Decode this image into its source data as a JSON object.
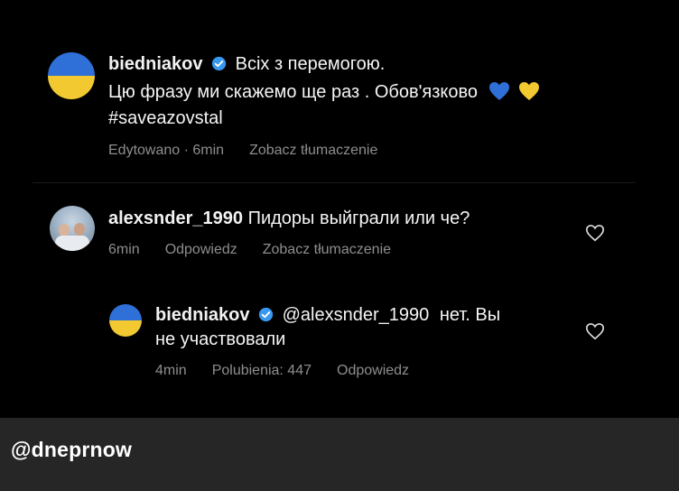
{
  "post": {
    "username": "biedniakov",
    "text_line1": "Всіх з перемогою.",
    "text_line2": "Цю фразу ми скажемо ще раз . Обов'язково",
    "hashtag": "#saveazovstal",
    "meta_edited": "Edytowano · 6min",
    "meta_translate": "Zobacz tłumaczenie",
    "hearts": [
      "blue-heart-emoji",
      "yellow-heart-emoji"
    ]
  },
  "comment1": {
    "username": "alexsnder_1990",
    "text": "Пидоры выйграли или че?",
    "time": "6min",
    "reply": "Odpowiedz",
    "translate": "Zobacz tłumaczenie"
  },
  "reply1": {
    "username": "biedniakov",
    "mention": "@alexsnder_1990",
    "text_line1_rest": "нет. Вы",
    "text_line2": "не участвовали",
    "time": "4min",
    "likes": "Polubienia: 447",
    "reply": "Odpowiedz"
  },
  "caption": "@dneprnow",
  "colors": {
    "background": "#000000",
    "text": "#f5f5f5",
    "meta": "#8e8e8e",
    "verified": "#3897f0",
    "flag_blue": "#2f6fd8",
    "flag_yellow": "#f2c930",
    "caption_bar": "#262626"
  }
}
